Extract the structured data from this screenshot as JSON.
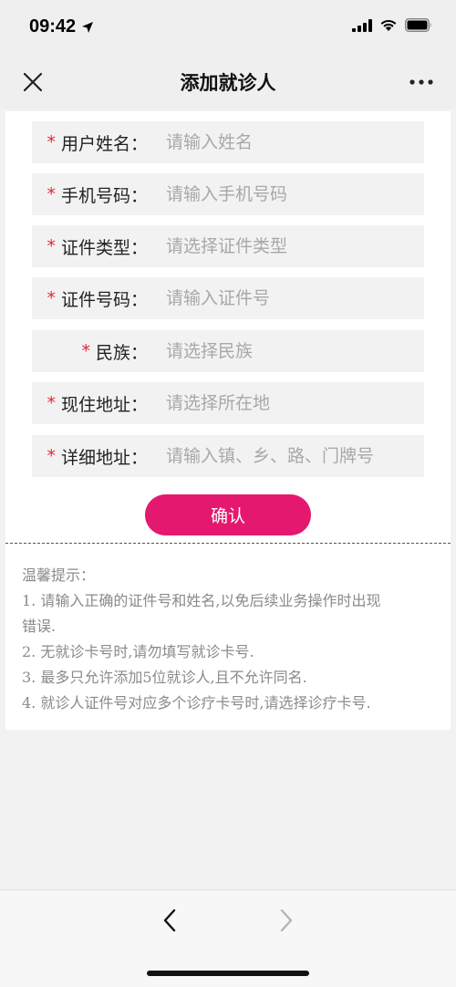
{
  "status_bar": {
    "time": "09:42"
  },
  "nav": {
    "title": "添加就诊人"
  },
  "form": {
    "fields": [
      {
        "label": "用户姓名：",
        "placeholder": "请输入姓名",
        "required_mark": "*"
      },
      {
        "label": "手机号码：",
        "placeholder": "请输入手机号码",
        "required_mark": "*"
      },
      {
        "label": "证件类型：",
        "placeholder": "请选择证件类型",
        "required_mark": "*"
      },
      {
        "label": "证件号码：",
        "placeholder": "请输入证件号",
        "required_mark": "*"
      },
      {
        "label": "民族：",
        "placeholder": "请选择民族",
        "required_mark": "*"
      },
      {
        "label": "现住地址：",
        "placeholder": "请选择所在地",
        "required_mark": "*"
      },
      {
        "label": "详细地址：",
        "placeholder": "请输入镇、乡、路、门牌号",
        "required_mark": "*"
      }
    ],
    "confirm_label": "确认"
  },
  "tips": {
    "title": "温馨提示：",
    "lines": [
      "1. 请输入正确的证件号和姓名,以免后续业务操作时出现",
      "错误.",
      "2. 无就诊卡号时,请勿填写就诊卡号.",
      "3. 最多只允许添加5位就诊人,且不允许同名.",
      "4. 就诊人证件号对应多个诊疗卡号时,请选择诊疗卡号."
    ]
  },
  "icons": {
    "close": "close-icon",
    "more": "more-dots-icon",
    "back": "chevron-left-icon",
    "forward": "chevron-right-icon",
    "location": "location-arrow-icon",
    "signal": "cellular-signal-icon",
    "wifi": "wifi-icon",
    "battery": "battery-icon"
  },
  "colors": {
    "accent": "#e5186f",
    "required": "#e0293a",
    "placeholder": "#a8a8a8",
    "tips_text": "#8a8a8a"
  }
}
